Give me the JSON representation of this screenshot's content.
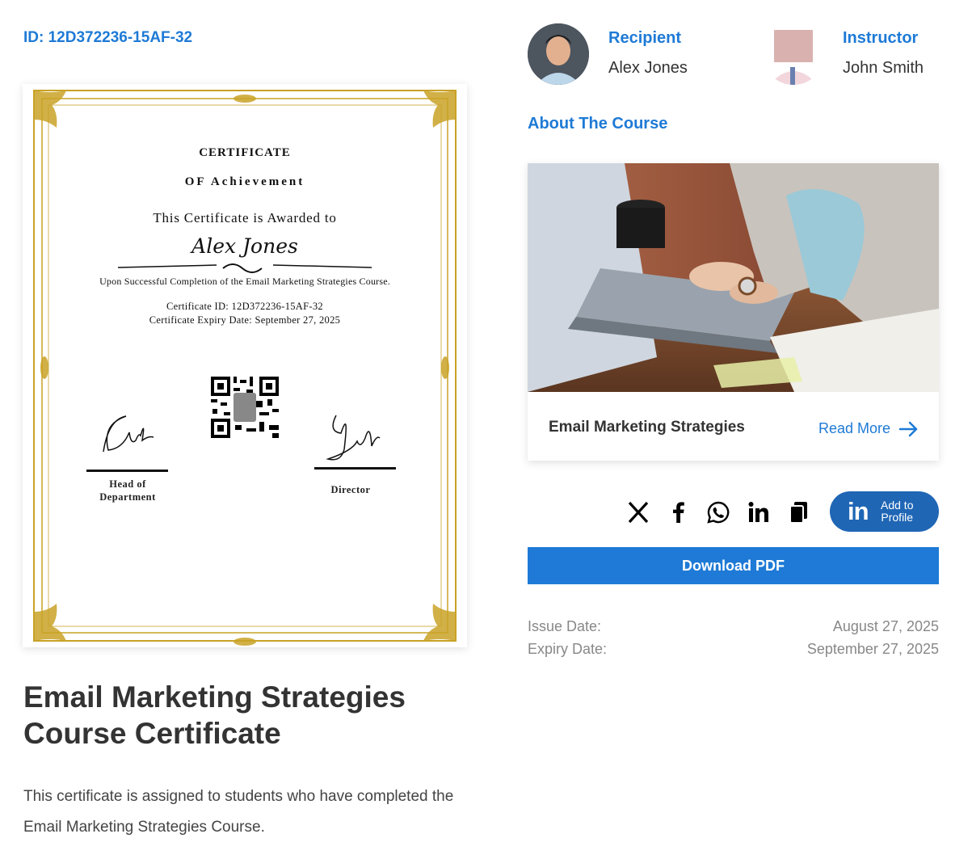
{
  "certificate": {
    "id_label": "ID: 12D372236-15AF-32",
    "title": "CERTIFICATE",
    "subtitle": "OF Achievement",
    "awarded": "This Certificate is Awarded to",
    "recipient_name": "Alex Jones",
    "completion": "Upon Successful Completion of the Email Marketing Strategies Course.",
    "id_line": "Certificate ID: 12D372236-15AF-32",
    "expiry_line": "Certificate Expiry Date: September 27, 2025",
    "signatures": [
      {
        "label_line1": "Head of",
        "label_line2": "Department"
      },
      {
        "label_line1": "Director"
      }
    ]
  },
  "course": {
    "heading": "Email Marketing Strategies Course Certificate",
    "description": "This certificate is assigned to students who have completed the Email Marketing Strategies Course."
  },
  "people": {
    "recipient": {
      "label": "Recipient",
      "name": "Alex Jones"
    },
    "instructor": {
      "label": "Instructor",
      "name": "John Smith"
    }
  },
  "about": {
    "title": "About The Course",
    "card_title": "Email Marketing Strategies",
    "read_more": "Read More"
  },
  "share": {
    "icons": [
      "x-icon",
      "facebook-icon",
      "whatsapp-icon",
      "linkedin-icon",
      "copy-icon"
    ],
    "add_profile_logo": "in",
    "add_profile_label_1": "Add to",
    "add_profile_label_2": "Profile"
  },
  "download": {
    "label": "Download PDF"
  },
  "dates": {
    "issue_label": "Issue Date:",
    "issue_value": "August 27, 2025",
    "expiry_label": "Expiry Date:",
    "expiry_value": "September 27, 2025"
  },
  "colors": {
    "accent": "#1e7ad6",
    "linkedin": "#1f66b5",
    "gold": "#c9a227"
  }
}
